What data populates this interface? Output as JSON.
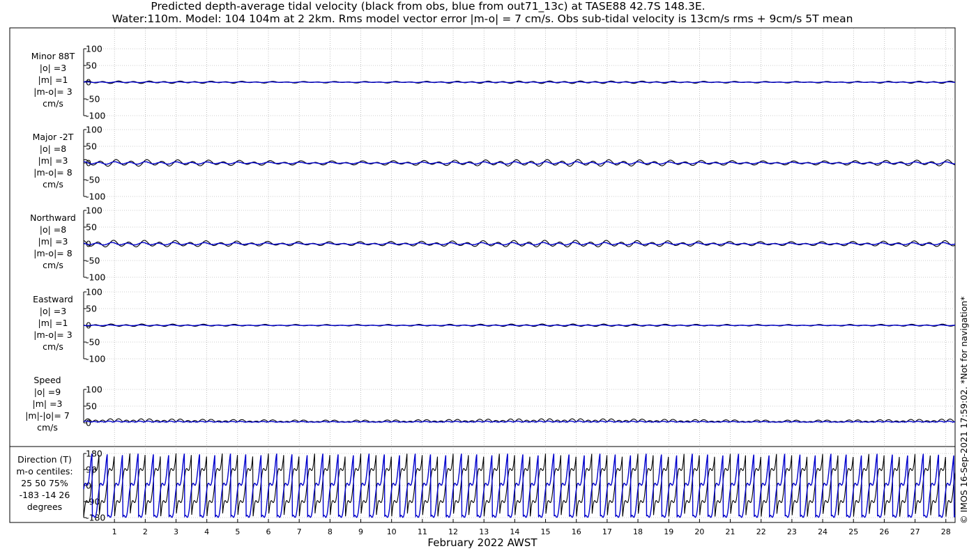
{
  "titles": {
    "line1": "Predicted depth-average tidal velocity (black from obs, blue from out71_13c) at TASE88 42.7S 148.3E.",
    "line2": "Water:110m. Model: 104 104m at 2 2km. Rms model vector error |m-o| = 7 cm/s. Obs sub-tidal velocity is 13cm/s rms + 9cm/s 5T mean"
  },
  "side_note": "© IMOS 16-Sep-2021 17:59:02. *Not for navigation*",
  "colors": {
    "obs": "#000000",
    "model": "#0000cc",
    "grid": "#999999"
  },
  "chart_data": {
    "type": "line",
    "xlabel": "February 2022 AWST",
    "xlim": [
      0,
      28.3
    ],
    "x_ticks": [
      "1",
      "2",
      "3",
      "4",
      "5",
      "6",
      "7",
      "8",
      "9",
      "10",
      "11",
      "12",
      "13",
      "14",
      "15",
      "16",
      "17",
      "18",
      "19",
      "20",
      "21",
      "22",
      "23",
      "24",
      "25",
      "26",
      "27",
      "28"
    ],
    "legend": {
      "obs": "black from obs",
      "model": "blue from out71_13c"
    },
    "panels": [
      {
        "id": "minor",
        "labels": [
          "Minor 88T",
          "|o| =3",
          "|m| =1",
          "|m-o|= 3",
          "cm/s"
        ],
        "ylim": [
          -100,
          100
        ],
        "y_ticks": [
          "100",
          "50",
          "0",
          "-50",
          "-100"
        ],
        "y_tick_values": [
          100,
          50,
          0,
          -50,
          -100
        ],
        "series": [
          {
            "name": "obs",
            "amp": 3
          },
          {
            "name": "model",
            "amp": 1
          }
        ]
      },
      {
        "id": "major",
        "labels": [
          "Major -2T",
          "|o| =8",
          "|m| =3",
          "|m-o|= 8",
          "cm/s"
        ],
        "ylim": [
          -100,
          100
        ],
        "y_ticks": [
          "100",
          "50",
          "0",
          "-50",
          "-100"
        ],
        "y_tick_values": [
          100,
          50,
          0,
          -50,
          -100
        ],
        "series": [
          {
            "name": "obs",
            "amp": 8
          },
          {
            "name": "model",
            "amp": 3
          }
        ]
      },
      {
        "id": "north",
        "labels": [
          "Northward",
          "|o| =8",
          "|m| =3",
          "|m-o|= 8",
          "cm/s"
        ],
        "ylim": [
          -100,
          100
        ],
        "y_ticks": [
          "100",
          "50",
          "0",
          "-50",
          "-100"
        ],
        "y_tick_values": [
          100,
          50,
          0,
          -50,
          -100
        ],
        "series": [
          {
            "name": "obs",
            "amp": 8
          },
          {
            "name": "model",
            "amp": 3
          }
        ]
      },
      {
        "id": "east",
        "labels": [
          "Eastward",
          "|o| =3",
          "|m| =1",
          "|m-o|= 3",
          "cm/s"
        ],
        "ylim": [
          -100,
          100
        ],
        "y_ticks": [
          "100",
          "50",
          "0",
          "-50",
          "-100"
        ],
        "y_tick_values": [
          100,
          50,
          0,
          -50,
          -100
        ],
        "series": [
          {
            "name": "obs",
            "amp": 3
          },
          {
            "name": "model",
            "amp": 1
          }
        ]
      },
      {
        "id": "speed",
        "labels": [
          "Speed",
          "|o| =9",
          "|m| =3",
          "|m|-|o|= 7",
          "cm/s"
        ],
        "ylim": [
          0,
          100
        ],
        "y_ticks": [
          "100",
          "50",
          "0"
        ],
        "y_tick_values": [
          100,
          50,
          0
        ],
        "series": [
          {
            "name": "obs",
            "amp": 9
          },
          {
            "name": "model",
            "amp": 3
          }
        ]
      },
      {
        "id": "direction",
        "labels": [
          "Direction (T)",
          "m-o centiles:",
          "25  50  75%",
          "-183  -14   26",
          "degrees"
        ],
        "ylim": [
          -180,
          180
        ],
        "y_ticks": [
          "180",
          "90",
          "0",
          "-90",
          "-180"
        ],
        "y_tick_values": [
          180,
          90,
          0,
          -90,
          -180
        ],
        "series": [
          {
            "name": "obs"
          },
          {
            "name": "model"
          }
        ]
      }
    ]
  }
}
